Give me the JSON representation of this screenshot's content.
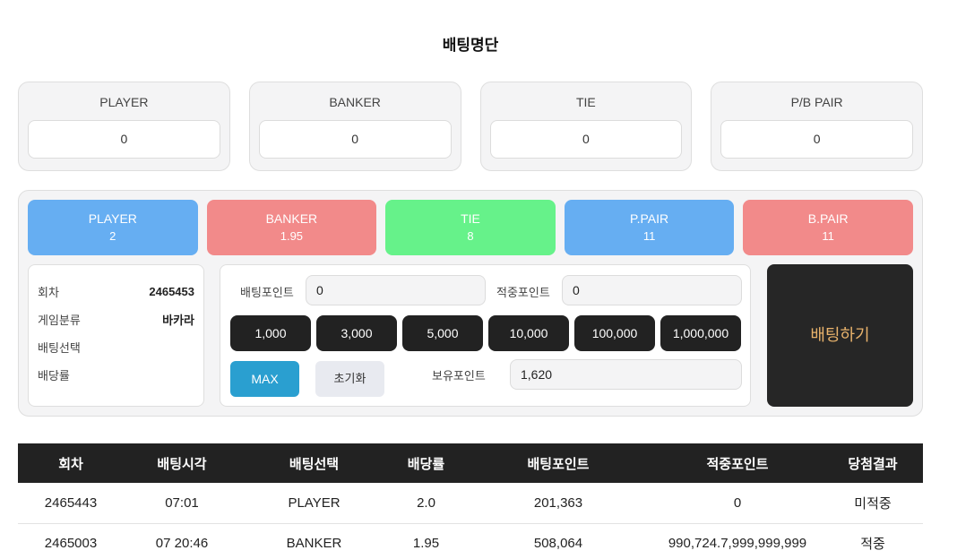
{
  "page": {
    "title": "배팅명단"
  },
  "totals": [
    {
      "label": "PLAYER",
      "value": "0"
    },
    {
      "label": "BANKER",
      "value": "0"
    },
    {
      "label": "TIE",
      "value": "0"
    },
    {
      "label": "P/B PAIR",
      "value": "0"
    }
  ],
  "odds": [
    {
      "label": "PLAYER",
      "value": "2",
      "color": "#66aef2"
    },
    {
      "label": "BANKER",
      "value": "1.95",
      "color": "#f28a8a"
    },
    {
      "label": "TIE",
      "value": "8",
      "color": "#66f28a"
    },
    {
      "label": "P.PAIR",
      "value": "11",
      "color": "#66aef2"
    },
    {
      "label": "B.PAIR",
      "value": "11",
      "color": "#f28a8a"
    }
  ],
  "info": {
    "round_label": "회차",
    "round_value": "2465453",
    "game_label": "게임분류",
    "game_value": "바카라",
    "selection_label": "배팅선택",
    "selection_value": "",
    "rate_label": "배당률",
    "rate_value": ""
  },
  "bet": {
    "bet_point_label": "배팅포인트",
    "bet_point_value": "0",
    "hit_point_label": "적중포인트",
    "hit_point_value": "0",
    "chips": [
      "1,000",
      "3,000",
      "5,000",
      "10,000",
      "100,000",
      "1,000,000"
    ],
    "max_label": "MAX",
    "reset_label": "초기화",
    "balance_label": "보유포인트",
    "balance_value": "1,620",
    "submit_label": "배팅하기"
  },
  "history": {
    "columns": [
      "회차",
      "배팅시각",
      "배팅선택",
      "배당률",
      "배팅포인트",
      "적중포인트",
      "당첨결과"
    ],
    "rows": [
      [
        "2465443",
        "07:01",
        "PLAYER",
        "2.0",
        "201,363",
        "0",
        "미적중"
      ],
      [
        "2465003",
        "07 20:46",
        "BANKER",
        "1.95",
        "508,064",
        "990,724.7,999,999,999",
        "적중"
      ]
    ]
  }
}
